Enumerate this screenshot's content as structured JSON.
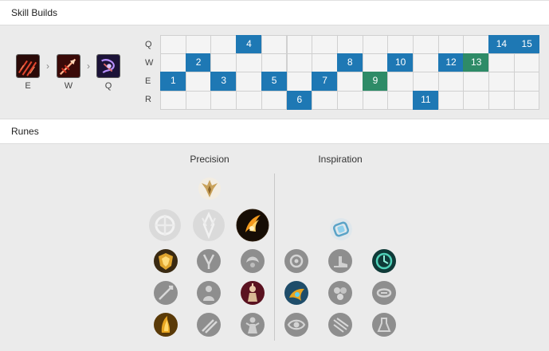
{
  "skill_builds": {
    "title": "Skill Builds",
    "order": [
      {
        "key": "E",
        "icon": "e-ability-icon",
        "color": "#7a1510"
      },
      {
        "key": "W",
        "icon": "w-ability-icon",
        "color": "#8c1a14"
      },
      {
        "key": "Q",
        "icon": "q-ability-icon",
        "color": "#3b1b6b"
      }
    ],
    "arrow": "›",
    "rows": [
      {
        "label": "Q",
        "levels": [
          4,
          14,
          15
        ]
      },
      {
        "label": "W",
        "levels": [
          2,
          8,
          10,
          12,
          13
        ]
      },
      {
        "label": "E",
        "levels": [
          1,
          3,
          5,
          7,
          9
        ]
      },
      {
        "label": "R",
        "levels": [
          6,
          11
        ]
      }
    ],
    "highlight_levels": [
      9,
      13
    ],
    "colors": {
      "active": "#1e78b4",
      "highlight": "#2e8b67"
    }
  },
  "runes": {
    "title": "Runes",
    "primary": {
      "name": "Precision",
      "keystones": [
        {
          "icon": "press-the-attack-icon",
          "selected": false
        },
        {
          "icon": "lethal-tempo-icon",
          "selected": false
        },
        {
          "icon": "fleet-footwork-icon",
          "selected": true
        }
      ],
      "rows": [
        [
          {
            "icon": "overheal-icon",
            "selected": true
          },
          {
            "icon": "triumph-icon",
            "selected": false
          },
          {
            "icon": "presence-of-mind-icon",
            "selected": false
          }
        ],
        [
          {
            "icon": "legend-alacrity-icon",
            "selected": false
          },
          {
            "icon": "legend-tenacity-icon",
            "selected": false
          },
          {
            "icon": "legend-bloodline-icon",
            "selected": true
          }
        ],
        [
          {
            "icon": "coup-de-grace-icon",
            "selected": true
          },
          {
            "icon": "cut-down-icon",
            "selected": false
          },
          {
            "icon": "last-stand-icon",
            "selected": false
          }
        ]
      ],
      "tree_icon": "precision-tree-icon"
    },
    "secondary": {
      "name": "Inspiration",
      "tree_icon": "inspiration-tree-icon",
      "rows": [
        [
          {
            "icon": "hextech-flashtraption-icon",
            "selected": false
          },
          {
            "icon": "magical-footwear-icon",
            "selected": false
          },
          {
            "icon": "perfect-timing-icon",
            "selected": true
          }
        ],
        [
          {
            "icon": "futures-market-icon",
            "selected": true
          },
          {
            "icon": "minion-dematerializer-icon",
            "selected": false
          },
          {
            "icon": "biscuit-delivery-icon",
            "selected": false
          }
        ],
        [
          {
            "icon": "cosmic-insight-icon",
            "selected": false
          },
          {
            "icon": "approach-velocity-icon",
            "selected": false
          },
          {
            "icon": "time-warp-tonic-icon",
            "selected": false
          }
        ]
      ]
    }
  }
}
